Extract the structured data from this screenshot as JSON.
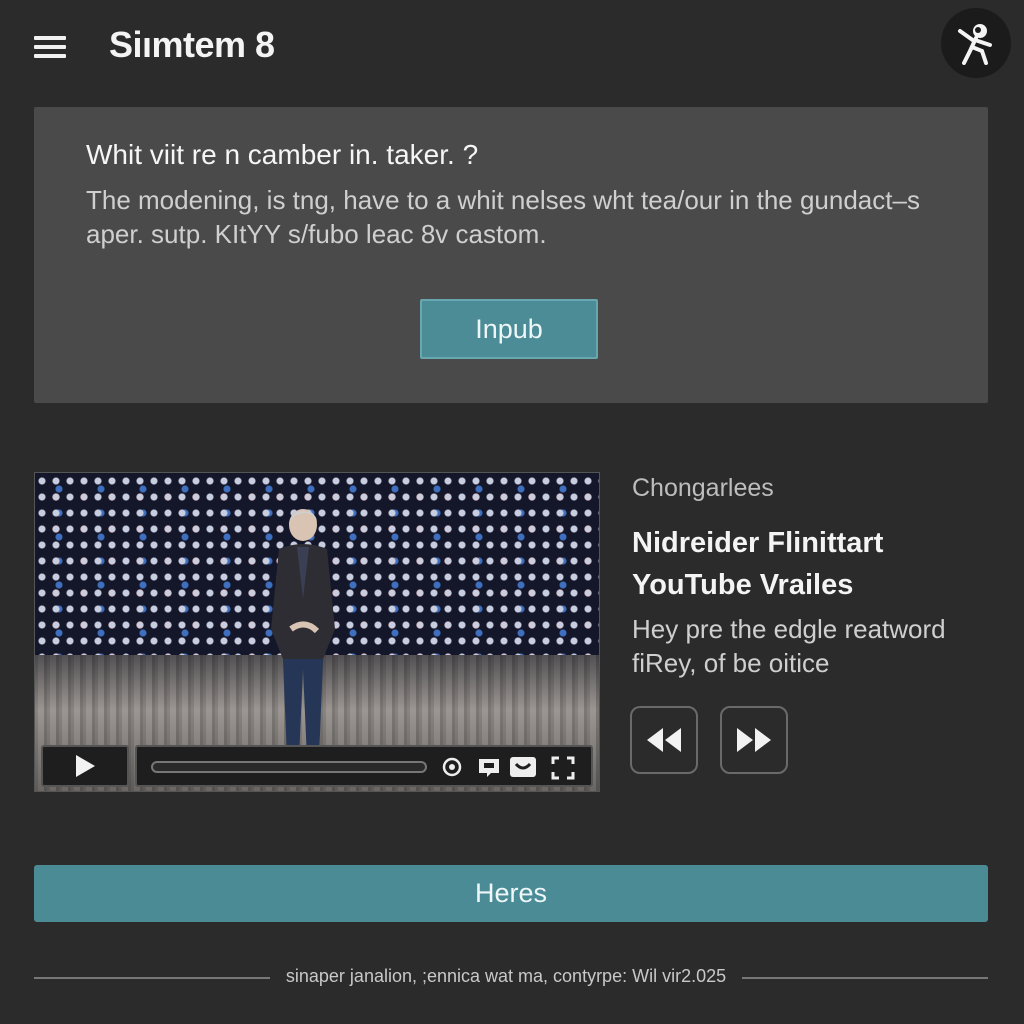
{
  "header": {
    "title": "Siımtem 8"
  },
  "card": {
    "title": "Whit viit re n camber in. taker. ?",
    "body": "The modening, is tng, have to a whit nelses wht tea/our in the gundact–s aper. sutp. KItYY s/fubo leac 8v castom.",
    "input_button_label": "Inpub"
  },
  "video": {
    "progress": 0
  },
  "side": {
    "category": "Chongarlees",
    "title": "Nidreider Flinittart YouTube Vrailes",
    "description": "Hey pre the edgle reatword fiRey, of be oitice"
  },
  "actions": {
    "wide_button_label": "Heres"
  },
  "footer": {
    "text": "sinaper janalion, ;ennica wat ma, contyrpe: Wil vir2.025"
  },
  "icons": {
    "menu": "menu-icon",
    "avatar": "avatar-icon",
    "play": "play-icon",
    "settings": "settings-icon",
    "captions": "captions-icon",
    "fullscreen": "fullscreen-icon",
    "prev": "rewind-icon",
    "next": "fast-forward-icon"
  },
  "colors": {
    "background": "#2b2b2c",
    "card": "#4a4a4b",
    "accent": "#4a8b96"
  }
}
